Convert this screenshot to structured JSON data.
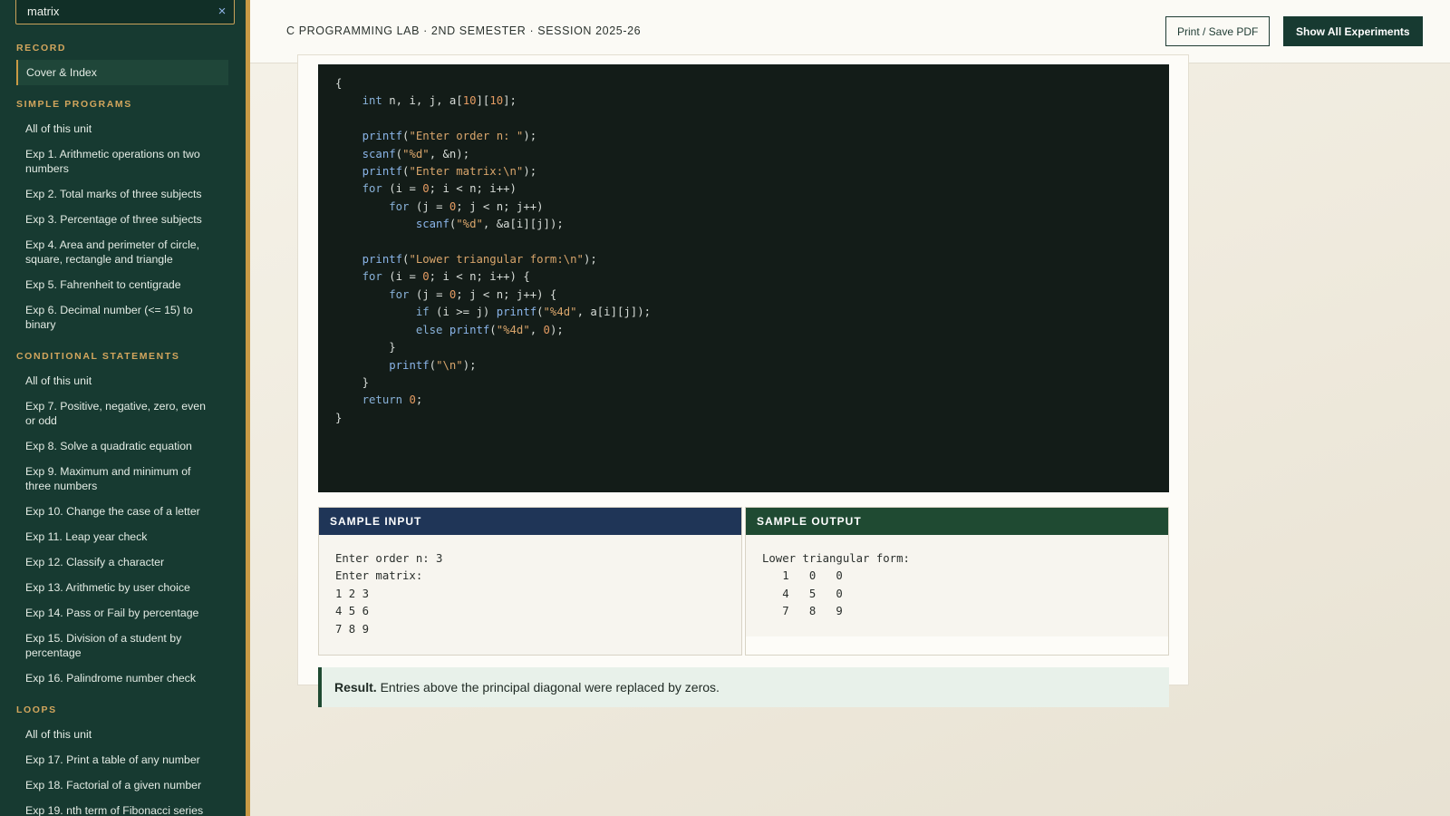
{
  "search": {
    "value": "matrix",
    "clear_icon": "×"
  },
  "sidebar": {
    "sections": [
      {
        "title": "RECORD",
        "items": [
          "Cover & Index"
        ]
      },
      {
        "title": "SIMPLE PROGRAMS",
        "items": [
          "All of this unit",
          "Exp 1. Arithmetic operations on two numbers",
          "Exp 2. Total marks of three subjects",
          "Exp 3. Percentage of three subjects",
          "Exp 4. Area and perimeter of circle, square, rectangle and triangle",
          "Exp 5. Fahrenheit to centigrade",
          "Exp 6. Decimal number (<= 15) to binary"
        ]
      },
      {
        "title": "CONDITIONAL STATEMENTS",
        "items": [
          "All of this unit",
          "Exp 7. Positive, negative, zero, even or odd",
          "Exp 8. Solve a quadratic equation",
          "Exp 9. Maximum and minimum of three numbers",
          "Exp 10. Change the case of a letter",
          "Exp 11. Leap year check",
          "Exp 12. Classify a character",
          "Exp 13. Arithmetic by user choice",
          "Exp 14. Pass or Fail by percentage",
          "Exp 15. Division of a student by percentage",
          "Exp 16. Palindrome number check"
        ]
      },
      {
        "title": "LOOPS",
        "items": [
          "All of this unit",
          "Exp 17. Print a table of any number",
          "Exp 18. Factorial of a given number",
          "Exp 19. nth term of Fibonacci series"
        ]
      }
    ]
  },
  "topbar": {
    "breadcrumb": "C PROGRAMMING LAB · 2ND SEMESTER · SESSION 2025-26",
    "print_label": "Print / Save PDF",
    "show_all_label": "Show All Experiments"
  },
  "code": {
    "lines": [
      "{",
      "    int n, i, j, a[10][10];",
      "",
      "    printf(\"Enter order n: \");",
      "    scanf(\"%d\", &n);",
      "    printf(\"Enter matrix:\\n\");",
      "    for (i = 0; i < n; i++)",
      "        for (j = 0; j < n; j++)",
      "            scanf(\"%d\", &a[i][j]);",
      "",
      "    printf(\"Lower triangular form:\\n\");",
      "    for (i = 0; i < n; i++) {",
      "        for (j = 0; j < n; j++) {",
      "            if (i >= j) printf(\"%4d\", a[i][j]);",
      "            else printf(\"%4d\", 0);",
      "        }",
      "        printf(\"\\n\");",
      "    }",
      "    return 0;",
      "}"
    ]
  },
  "sample_input": {
    "title": "SAMPLE INPUT",
    "text": "Enter order n: 3\nEnter matrix:\n1 2 3\n4 5 6\n7 8 9"
  },
  "sample_output": {
    "title": "SAMPLE OUTPUT",
    "text": "Lower triangular form:\n   1   0   0\n   4   5   0\n   7   8   9"
  },
  "result": {
    "label": "Result.",
    "text": "Entries above the principal diagonal were replaced by zeros."
  },
  "colors": {
    "sidebar_bg": "#173a31",
    "accent_gold": "#c99a45",
    "input_header": "#1f3557",
    "output_header": "#1f4a32",
    "code_bg": "#131c18"
  }
}
